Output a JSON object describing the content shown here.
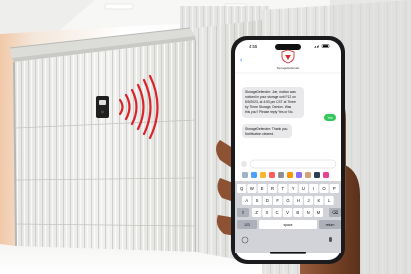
{
  "status_bar": {
    "time": "4:55"
  },
  "conversation": {
    "contact_name": "StorageDefender",
    "messages": [
      {
        "from": "them",
        "lines": [
          "StorageDefender: Joe, motion was",
          "noticed in your storage unit F12 on",
          "8/9/2023, at 4:53 pm CST at Three",
          "by Three Storage, Denton. Was",
          "this you? Please reply Yes or No."
        ]
      },
      {
        "from": "me",
        "lines": [
          "Yes"
        ]
      },
      {
        "from": "them",
        "lines": [
          "StorageDefender: Thank you.",
          "Notification cleared."
        ]
      }
    ]
  },
  "keyboard": {
    "row1": [
      "Q",
      "W",
      "E",
      "R",
      "T",
      "Y",
      "U",
      "I",
      "O",
      "P"
    ],
    "row2": [
      "A",
      "S",
      "D",
      "F",
      "G",
      "H",
      "J",
      "K",
      "L"
    ],
    "row3": [
      "Z",
      "X",
      "C",
      "V",
      "B",
      "N",
      "M"
    ],
    "numbers_key": "123",
    "space_key": "space",
    "return_key": "return"
  },
  "colors": {
    "imessage_blue": "#2f7bf6",
    "sms_green": "#34c759",
    "sensor_waves": "#d8262c",
    "shield_red": "#d32f2f"
  }
}
